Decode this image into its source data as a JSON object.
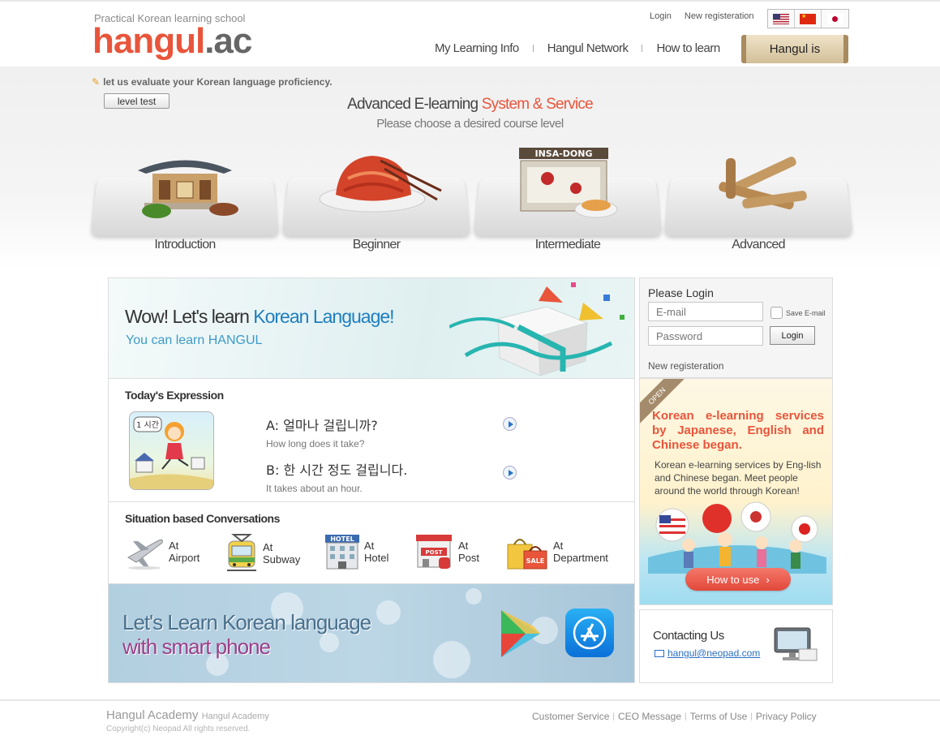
{
  "header": {
    "tagline": "Practical Korean learning school",
    "logo_part1": "hangul",
    "logo_part2": ".ac",
    "top_links": {
      "login": "Login",
      "register": "New registeration"
    },
    "nav": [
      "My Learning Info",
      "Hangul Network",
      "How to learn"
    ],
    "hangul_is": "Hangul is"
  },
  "level_test": {
    "note": "let us evaluate your Korean language proficiency.",
    "button": "level test"
  },
  "intro": {
    "title_main": "Advanced E-learning ",
    "title_highlight": "System & Service",
    "subtitle": "Please choose a desired course level"
  },
  "courses": [
    "Introduction",
    "Beginner",
    "Intermediate",
    "Advanced"
  ],
  "banner_top": {
    "title_a": "Wow! Let's learn ",
    "title_b": "Korean Language!",
    "subtitle": "You can learn HANGUL"
  },
  "today_expression": {
    "title": "Today's Expression",
    "cartoon_caption": "1 시간",
    "lines": [
      {
        "ko": "A: 얼마나 걸립니까?",
        "en": "How long does it take?"
      },
      {
        "ko": "B: 한 시간 정도 걸립니다.",
        "en": "It takes about an hour."
      }
    ]
  },
  "situations": {
    "title": "Situation based Conversations",
    "items": [
      {
        "line1": "At",
        "line2": "Airport",
        "icon": "airplane-icon"
      },
      {
        "line1": "At",
        "line2": "Subway",
        "icon": "subway-icon"
      },
      {
        "line1": "At",
        "line2": "Hotel",
        "icon": "hotel-icon"
      },
      {
        "line1": "At",
        "line2": "Post",
        "icon": "post-office-icon"
      },
      {
        "line1": "At",
        "line2": "Department",
        "icon": "shopping-bag-icon"
      }
    ]
  },
  "banner_bottom": {
    "line1": "Let's  Learn Korean language",
    "line2": "with smart  phone"
  },
  "login": {
    "title": "Please Login",
    "email_placeholder": "E-mail",
    "password_placeholder": "Password",
    "save_email": "Save E-mail",
    "button": "Login",
    "register": "New registeration"
  },
  "promo": {
    "ribbon": "OPEN",
    "title": "Korean e-learning services by Japanese, English and Chinese began.",
    "body": "Korean e-learning services by Eng-lish and Chinese began. Meet people around the world through Korean!",
    "button": "How to use",
    "button_arrow": "›"
  },
  "contact": {
    "title": "Contacting Us",
    "email": "hangul@neopad.com"
  },
  "footer": {
    "name": "Hangul Academy",
    "name_small": "Hangul Academy",
    "copyright": "Copyright(c) Neopad All rights reserved.",
    "links": [
      "Customer Service",
      "CEO Message",
      "Terms of Use",
      "Privacy Policy"
    ]
  },
  "colors": {
    "accent": "#e8553b",
    "link_blue": "#2a6fc4",
    "brand_gray": "#666666"
  }
}
